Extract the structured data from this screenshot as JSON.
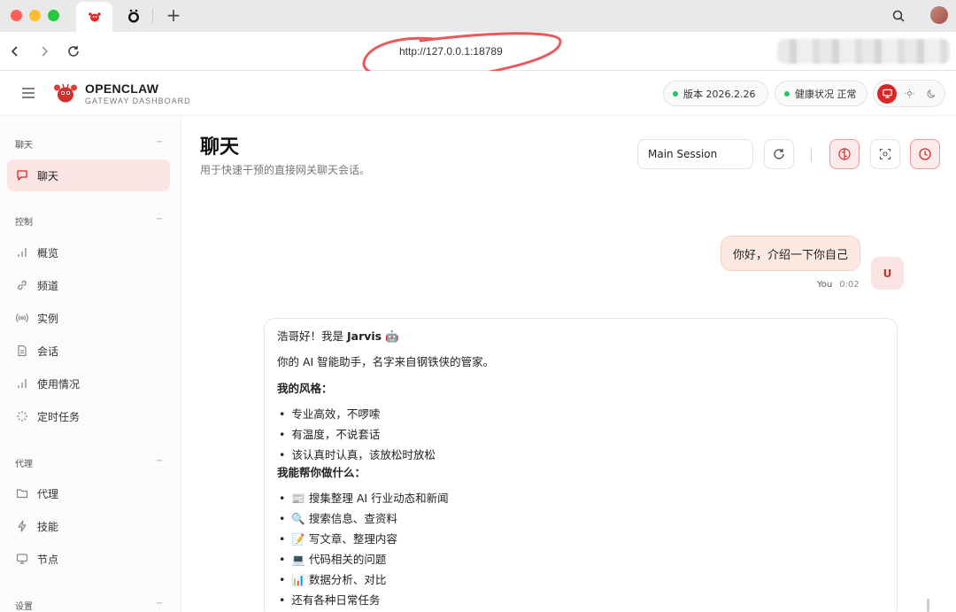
{
  "browser": {
    "url": "http://127.0.0.1:18789",
    "new_tab": "+"
  },
  "header": {
    "brand_title": "OPENCLAW",
    "brand_subtitle": "GATEWAY DASHBOARD",
    "version_label": "版本 2026.2.26",
    "health_label": "健康状况 正常",
    "status_color": "#22c55e",
    "accent": "#dc2626"
  },
  "sidebar": {
    "groups": [
      {
        "title": "聊天",
        "collapse": "−",
        "items": [
          {
            "label": "聊天",
            "icon": "chat-icon",
            "active": true
          }
        ]
      },
      {
        "title": "控制",
        "collapse": "−",
        "items": [
          {
            "label": "概览",
            "icon": "bar-chart-icon"
          },
          {
            "label": "频道",
            "icon": "link-icon"
          },
          {
            "label": "实例",
            "icon": "radio-icon"
          },
          {
            "label": "会话",
            "icon": "document-icon"
          },
          {
            "label": "使用情况",
            "icon": "bar-chart-icon"
          },
          {
            "label": "定时任务",
            "icon": "loader-icon"
          }
        ]
      },
      {
        "title": "代理",
        "collapse": "−",
        "items": [
          {
            "label": "代理",
            "icon": "folder-icon"
          },
          {
            "label": "技能",
            "icon": "bolt-icon"
          },
          {
            "label": "节点",
            "icon": "monitor-icon"
          }
        ]
      },
      {
        "title": "设置",
        "collapse": "−"
      }
    ]
  },
  "main": {
    "title": "聊天",
    "subtitle": "用于快速干预的直接网关聊天会话。",
    "session": "Main Session"
  },
  "chat": {
    "user_message": "你好，介绍一下你自己",
    "user_name": "You",
    "user_time": "0:02",
    "user_avatar": "U",
    "ai": {
      "greeting_prefix": "浩哥好！我是 ",
      "greeting_name": "Jarvis",
      "greeting_emoji": "🤖",
      "intro": "你的 AI 智能助手，名字来自钢铁侠的管家。",
      "style_heading": "我的风格：",
      "style_items": [
        "专业高效，不啰嗦",
        "有温度，不说套话",
        "该认真时认真，该放松时放松"
      ],
      "help_heading": "我能帮你做什么：",
      "help_items": [
        "📰 搜集整理 AI 行业动态和新闻",
        "🔍 搜索信息、查资料",
        "📝 写文章、整理内容",
        "💻 代码相关的问题",
        "📊 数据分析、对比",
        "还有各种日常任务"
      ]
    }
  }
}
